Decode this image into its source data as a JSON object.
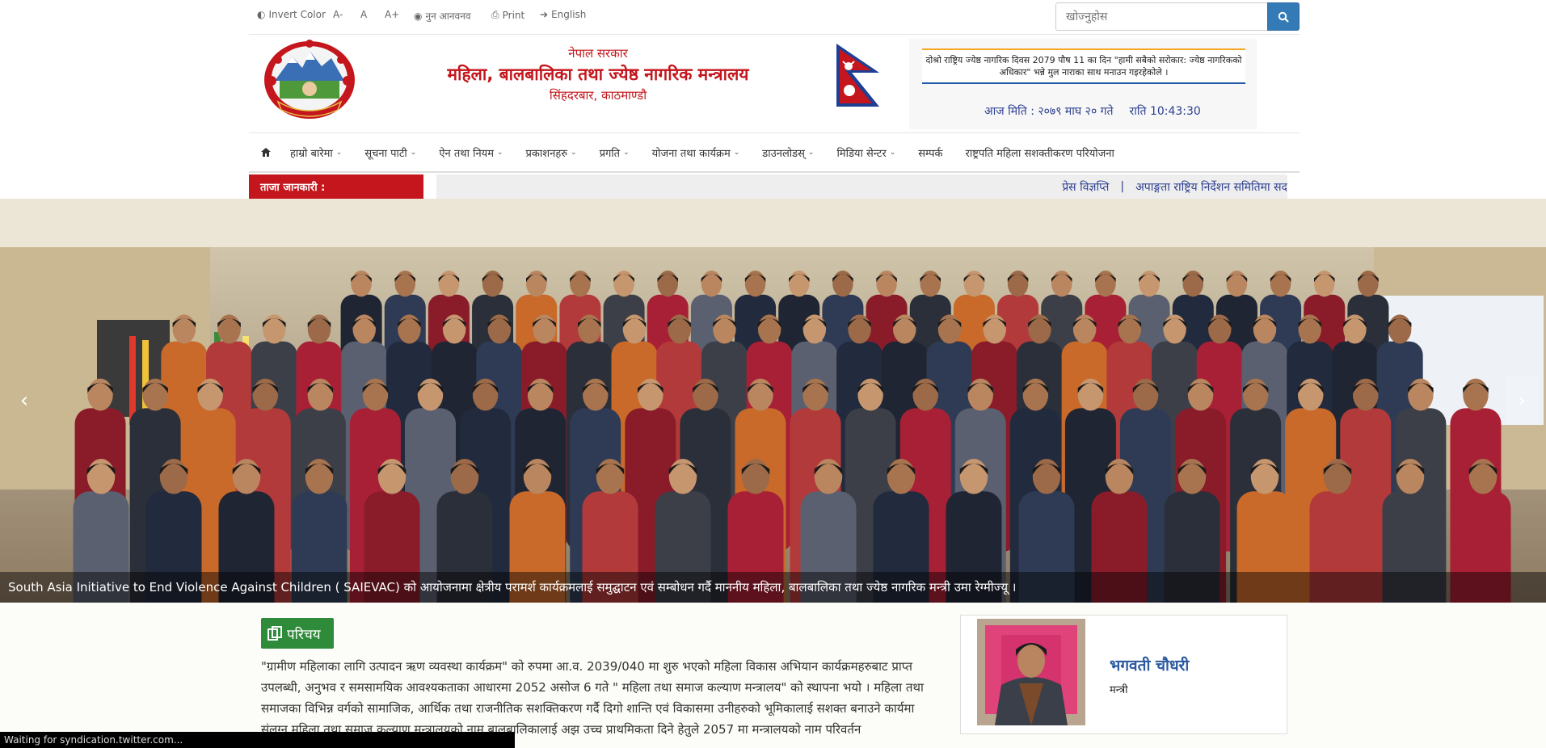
{
  "utility": {
    "invert": "Invert Color",
    "font_small": "A-",
    "font_normal": "A",
    "font_large": "A+",
    "new_version": "नुन आनवनव",
    "print": "Print",
    "english": "English"
  },
  "search": {
    "placeholder": "खोज्नुहोस"
  },
  "header": {
    "gov": "नेपाल सरकार",
    "ministry": "महिला, बालबालिका तथा ज्येष्ठ नागरिक मन्त्रालय",
    "location": "सिंहदरबार, काठमाण्डौ",
    "notice": "दोश्रो राष्ट्रिय ज्येष्ठ नागरिक दिवस 2079 पौष 11 का दिन \"हामी सबैको सरोकार: ज्येष्ठ नागरिकको अधिकार\" भन्ने मुल नाराका साथ मनाउन गइरहेकोले ।",
    "date": "आज मिति : २०७९ माघ २० गते",
    "time": "राति 10:43:30"
  },
  "nav": {
    "items": [
      {
        "label": "हाम्रो बारेमा",
        "dropdown": true
      },
      {
        "label": "सूचना पाटी",
        "dropdown": true
      },
      {
        "label": "ऐन तथा नियम",
        "dropdown": true
      },
      {
        "label": "प्रकाशनहरु",
        "dropdown": true
      },
      {
        "label": "प्रगति",
        "dropdown": true
      },
      {
        "label": "योजना तथा कार्यक्रम",
        "dropdown": true
      },
      {
        "label": "डाउनलोडस्",
        "dropdown": true
      },
      {
        "label": "मिडिया सेन्टर",
        "dropdown": true
      },
      {
        "label": "सम्पर्क",
        "dropdown": false
      },
      {
        "label": "राष्ट्रपति महिला सशक्तीकरण परियोजना",
        "dropdown": false
      }
    ]
  },
  "latest": {
    "label": "ताजा जानकारी :",
    "item1": "प्रेस विज्ञप्ति",
    "separator": "|",
    "item2": "अपाङ्गता राष्ट्रिय निर्देशन समितिमा सद"
  },
  "slider": {
    "caption": "South Asia Initiative to End Violence Against Children ( SAIEVAC) को आयोजनामा क्षेत्रीय परामर्श कार्यक्रमलाई समुद्घाटन एवं सम्बोधन गर्दै माननीय महिला, बालबालिका तथा ज्येष्ठ नागरिक मन्त्री उमा रेग्मीज्यू ।"
  },
  "intro": {
    "badge": "परिचय",
    "text": "\"ग्रामीण महिलाका लागि उत्पादन ऋण व्यवस्था कार्यक्रम\" को रुपमा आ.व. 2039/040 मा शुरु भएको महिला विकास अभियान कार्यक्रमहरुबाट प्राप्त उपलब्धी, अनुभव र समसामयिक आवश्यकताका आधारमा 2052 असोज 6 गते \" महिला तथा समाज कल्याण मन्त्रालय\" को स्थापना भयो । महिला तथा समाजका विभिन्न वर्गको सामाजिक, आर्थिक तथा राजनीतिक सशक्तिकरण गर्दै दिगो शान्ति एवं विकासमा उनीहरुको भूमिकालाई सशक्त बनाउने कार्यमा संलग्न महिला तथा समाज कल्याण मन्त्रालयको नाम बालबालिकालाई अझ उच्च प्राथमिकता दिने हेतुले 2057 मा मन्त्रालयको नाम परिवर्तन"
  },
  "minister": {
    "name": "भगवती चौधरी",
    "role": "मन्त्री"
  },
  "status": "Waiting for syndication.twitter.com..."
}
